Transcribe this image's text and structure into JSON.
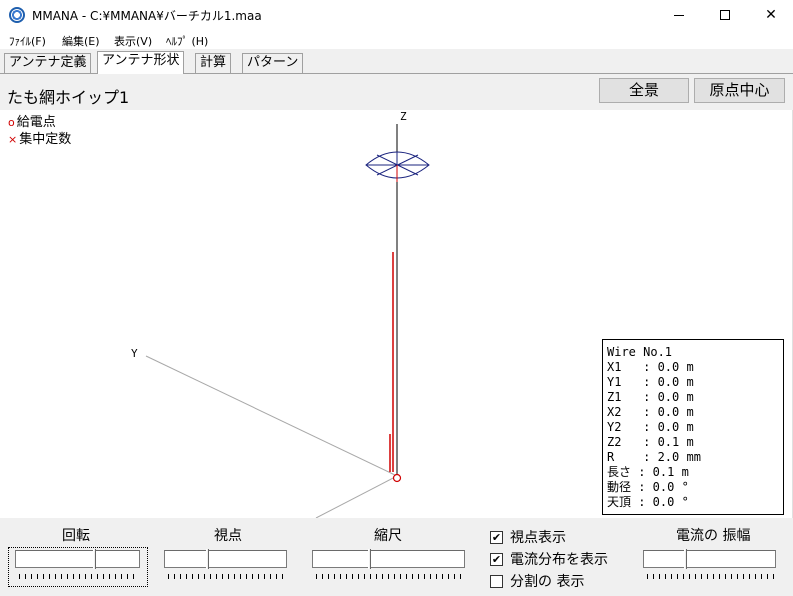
{
  "window": {
    "title": "MMANA - C:¥MMANA¥バーチカル1.maa",
    "minimize": "—",
    "close": "✕"
  },
  "menu": {
    "items": [
      "ﾌｧｲﾙ(F)",
      "編集(E)",
      "表示(V)",
      "ﾍﾙﾌﾟ (H)"
    ]
  },
  "tabs": [
    "アンテナ定義",
    "アンテナ形状",
    "計算",
    "パターン"
  ],
  "active_tab": 1,
  "header": {
    "antenna_name": "たも網ホイップ1",
    "btn_full_view": "全景",
    "btn_origin_center": "原点中心"
  },
  "legend": {
    "feed_marker": "o",
    "feed_label": "給電点",
    "load_marker": "×",
    "load_label": "集中定数"
  },
  "axes": {
    "z": "Z",
    "y": "Y"
  },
  "colors": {
    "wire": "#000000",
    "current": "#d00000",
    "loop": "#1a237e",
    "axis": "#a0a0a0"
  },
  "wire_info": {
    "lines": [
      "Wire No.1",
      "X1   : 0.0 m",
      "Y1   : 0.0 m",
      "Z1   : 0.0 m",
      "X2   : 0.0 m",
      "Y2   : 0.0 m",
      "Z2   : 0.1 m",
      "R    : 2.0 mm",
      "長さ : 0.1 m",
      "動径 : 0.0 °",
      "天頂 : 0.0 °"
    ]
  },
  "controls": {
    "rotate_label": "回転",
    "viewpoint_label": "視点",
    "scale_label": "縮尺",
    "show_viewpoint": "視点表示",
    "show_viewpoint_checked": true,
    "show_current": "電流分布を表示",
    "show_current_checked": true,
    "show_segments": "分割の 表示",
    "show_segments_checked": false,
    "current_amplitude_label": "電流の 振幅"
  }
}
